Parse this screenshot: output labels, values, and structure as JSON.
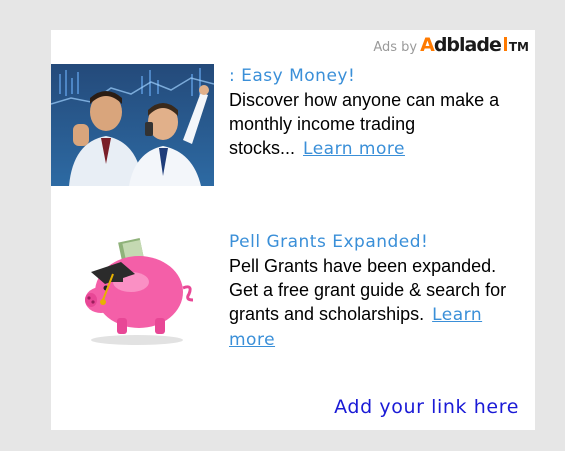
{
  "attribution": {
    "ads_by": "Ads by",
    "logo_a": "A",
    "logo_rest": "dblade",
    "tm": "TM"
  },
  "ads": [
    {
      "headline": ": Easy Money!",
      "body": "Discover how anyone can make a monthly income trading stocks...",
      "learn_more": "Learn more",
      "image_icon": "traders-photo"
    },
    {
      "headline": "Pell Grants Expanded!",
      "body": "Pell Grants have been expanded. Get a free grant guide & search for grants and scholarships.",
      "learn_more": "Learn more",
      "image_icon": "piggy-bank-graduation"
    }
  ],
  "footer": {
    "add_link": "Add your link here"
  },
  "colors": {
    "background": "#e6e6e6",
    "link": "#3a8fd8",
    "add_link": "#1a1ad6",
    "logo_accent": "#ff7a00"
  }
}
